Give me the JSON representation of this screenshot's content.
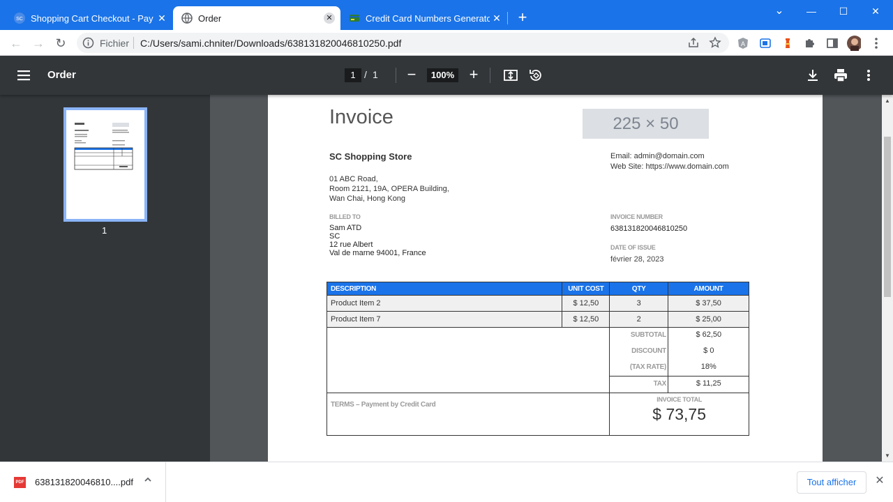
{
  "tabs": [
    {
      "title": "Shopping Cart Checkout - Paypal",
      "favicon_text": "SC"
    },
    {
      "title": "Order"
    },
    {
      "title": "Credit Card Numbers Generator |"
    }
  ],
  "new_tab_symbol": "+",
  "window": {
    "minimize": "—",
    "restore": "☐",
    "close": "✕",
    "tab_search": "⌄"
  },
  "address": {
    "scheme": "Fichier",
    "url": "C:/Users/sami.chniter/Downloads/638131820046810250.pdf"
  },
  "pdf_toolbar": {
    "title": "Order",
    "current_page": "1",
    "page_separator": "/",
    "total_pages": "1",
    "zoom": "100%"
  },
  "thumbnail": {
    "page_label": "1"
  },
  "invoice": {
    "title": "Invoice",
    "logo_placeholder": "225 × 50",
    "store_name": "SC Shopping Store",
    "address_lines": [
      "01 ABC Road,",
      "Room 2121, 19A, OPERA Building,",
      "Wan Chai, Hong Kong"
    ],
    "email": "Email: admin@domain.com",
    "website": "Web Site: https://www.domain.com",
    "billed_to_label": "BILLED TO",
    "billed_to_lines": [
      "Sam ATD",
      "SC",
      "12 rue Albert",
      "Val de marne 94001, France"
    ],
    "invoice_number_label": "INVOICE NUMBER",
    "invoice_number": "638131820046810250",
    "date_label": "DATE OF ISSUE",
    "date": "février 28, 2023",
    "columns": [
      "DESCRIPTION",
      "UNIT COST",
      "QTY",
      "AMOUNT"
    ],
    "rows": [
      {
        "description": "Product Item 2",
        "unit_cost": "$ 12,50",
        "qty": "3",
        "amount": "$ 37,50"
      },
      {
        "description": "Product Item 7",
        "unit_cost": "$ 12,50",
        "qty": "2",
        "amount": "$ 25,00"
      }
    ],
    "subtotal_label": "SUBTOTAL",
    "subtotal": "$ 62,50",
    "discount_label": "DISCOUNT",
    "discount": "$ 0",
    "tax_rate_label": "(TAX RATE)",
    "tax_rate": "18%",
    "tax_label": "TAX",
    "tax": "$ 11,25",
    "terms": "TERMS – Payment by Credit Card",
    "total_label": "INVOICE TOTAL",
    "total": "$ 73,75"
  },
  "download": {
    "filename": "638131820046810....pdf",
    "file_type": "PDF",
    "show_all": "Tout afficher"
  },
  "colors": {
    "chrome_blue": "#1a73e8",
    "pdf_toolbar": "#323639",
    "viewer_bg": "#525659"
  }
}
